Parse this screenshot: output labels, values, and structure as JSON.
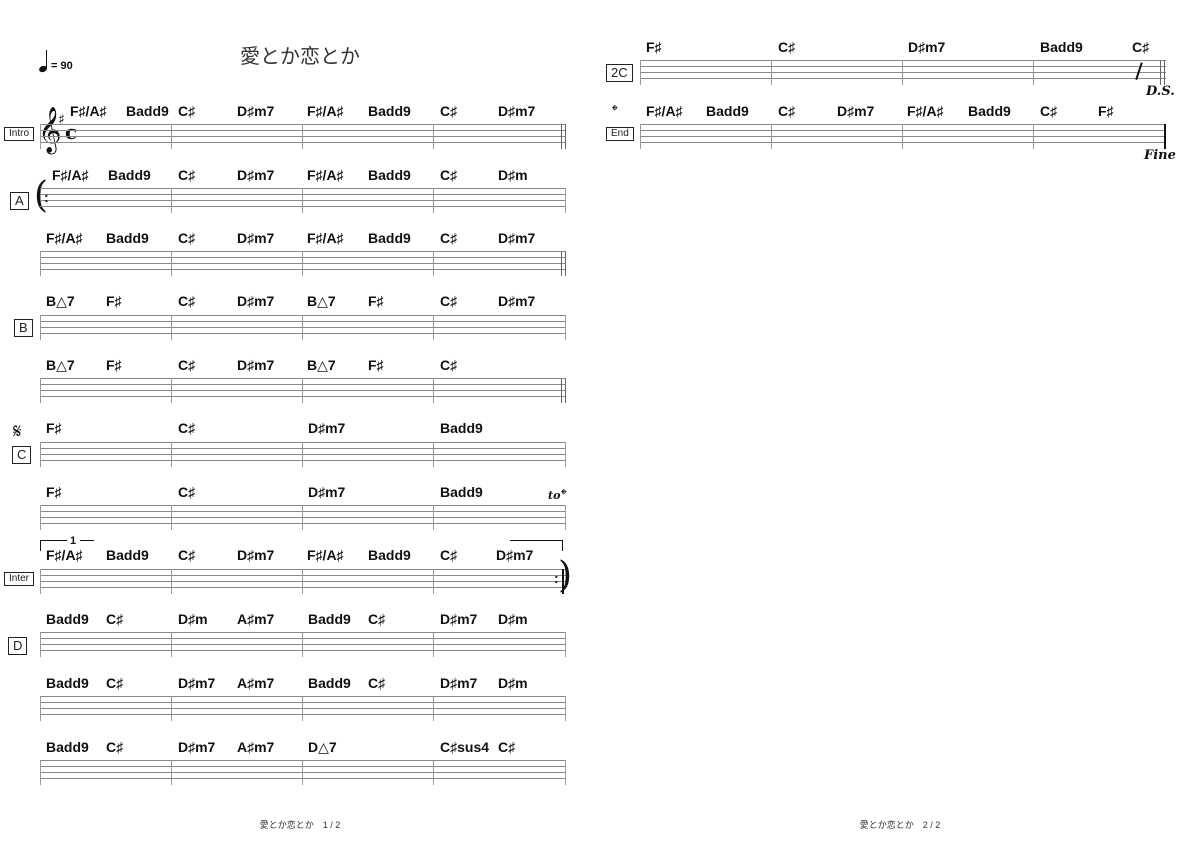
{
  "page1": {
    "title": "愛とか恋とか",
    "tempo": "= 90",
    "footer": "愛とか恋とか　1 / 2"
  },
  "page2": {
    "footer": "愛とか恋とか　2 / 2"
  },
  "marks": {
    "ds": "D.S.",
    "fine": "Fine",
    "to_coda": "to",
    "segno_glyph": "𝄋",
    "coda_glyph": "𝄌",
    "clef_glyph": "𝄞",
    "sharp_glyph": "♯",
    "time_glyph": "c",
    "volta_1": "1"
  },
  "systems": [
    {
      "label": "Intro",
      "label_size": "small",
      "chords": [
        "F♯/A♯",
        "Badd9",
        "C♯",
        "D♯m7",
        "F♯/A♯",
        "Badd9",
        "C♯",
        "D♯m7"
      ]
    },
    {
      "label": "A",
      "label_size": "large",
      "chords": [
        "F♯/A♯",
        "Badd9",
        "C♯",
        "D♯m7",
        "F♯/A♯",
        "Badd9",
        "C♯",
        "D♯m"
      ]
    },
    {
      "label": "",
      "chords": [
        "F♯/A♯",
        "Badd9",
        "C♯",
        "D♯m7",
        "F♯/A♯",
        "Badd9",
        "C♯",
        "D♯m7"
      ]
    },
    {
      "label": "B",
      "label_size": "large",
      "chords": [
        "B△7",
        "F♯",
        "C♯",
        "D♯m7",
        "B△7",
        "F♯",
        "C♯",
        "D♯m7"
      ]
    },
    {
      "label": "",
      "chords": [
        "B△7",
        "F♯",
        "C♯",
        "D♯m7",
        "B△7",
        "F♯",
        "C♯"
      ]
    },
    {
      "label": "C",
      "label_size": "large",
      "chords": [
        "F♯",
        "C♯",
        "D♯m7",
        "Badd9"
      ]
    },
    {
      "label": "",
      "chords": [
        "F♯",
        "C♯",
        "D♯m7",
        "Badd9"
      ]
    },
    {
      "label": "Inter",
      "label_size": "small",
      "chords": [
        "F♯/A♯",
        "Badd9",
        "C♯",
        "D♯m7",
        "F♯/A♯",
        "Badd9",
        "C♯",
        "D♯m7"
      ]
    },
    {
      "label": "D",
      "label_size": "large",
      "chords": [
        "Badd9",
        "C♯",
        "D♯m",
        "A♯m7",
        "Badd9",
        "C♯",
        "D♯m7",
        "D♯m"
      ]
    },
    {
      "label": "",
      "chords": [
        "Badd9",
        "C♯",
        "D♯m7",
        "A♯m7",
        "Badd9",
        "C♯",
        "D♯m7",
        "D♯m"
      ]
    },
    {
      "label": "",
      "chords": [
        "Badd9",
        "C♯",
        "D♯m7",
        "A♯m7",
        "D△7",
        "C♯sus4",
        "C♯"
      ]
    },
    {
      "label": "2C",
      "label_size": "large",
      "chords": [
        "F♯",
        "C♯",
        "D♯m7",
        "Badd9",
        "C♯"
      ]
    },
    {
      "label": "End",
      "label_size": "small",
      "chords": [
        "F♯/A♯",
        "Badd9",
        "C♯",
        "D♯m7",
        "F♯/A♯",
        "Badd9",
        "C♯",
        "F♯"
      ]
    }
  ]
}
